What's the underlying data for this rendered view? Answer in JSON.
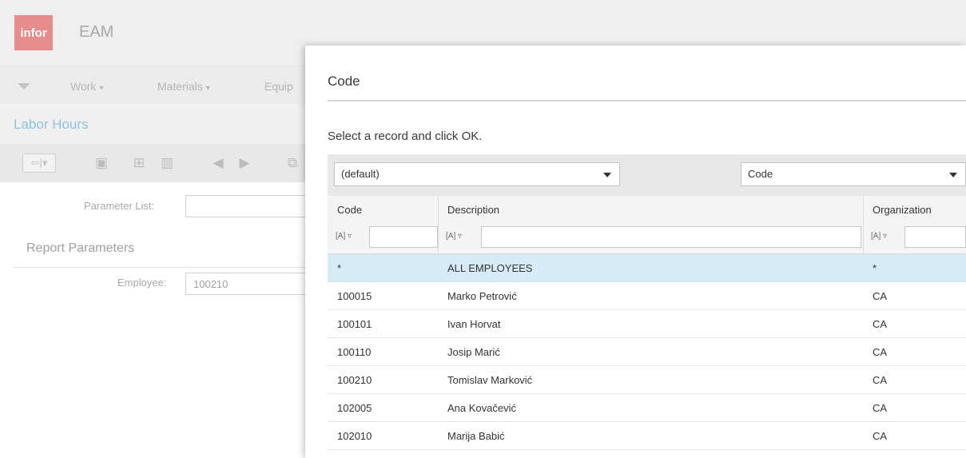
{
  "app": {
    "logo_text": "infor",
    "name": "EAM"
  },
  "menu": {
    "items": [
      "Work",
      "Materials",
      "Equip"
    ]
  },
  "page": {
    "title": "Labor Hours"
  },
  "form": {
    "parameter_list_label": "Parameter List:",
    "parameter_list_value": "",
    "report_params_heading": "Report Parameters",
    "employee_label": "Employee:",
    "employee_value": "100210"
  },
  "dialog": {
    "title": "Code",
    "instruction": "Select a record and click OK.",
    "dataspy_select": "(default)",
    "field_select": "Code",
    "columns": [
      "Code",
      "Description",
      "Organization"
    ],
    "filter_tag": "[A] ▿",
    "rows": [
      {
        "code": "*",
        "description": "ALL EMPLOYEES",
        "organization": "*",
        "selected": true
      },
      {
        "code": "100015",
        "description": "Marko Petrović",
        "organization": "CA"
      },
      {
        "code": "100101",
        "description": "Ivan Horvat",
        "organization": "CA"
      },
      {
        "code": "100110",
        "description": "Josip Marić",
        "organization": "CA"
      },
      {
        "code": "100210",
        "description": "Tomislav Marković",
        "organization": "CA"
      },
      {
        "code": "102005",
        "description": "Ana Kovačević",
        "organization": "CA"
      },
      {
        "code": "102010",
        "description": "Marija Babić",
        "organization": "CA"
      }
    ]
  },
  "colors": {
    "logo_bg": "#e58c8c",
    "title_accent": "#8dc3e0",
    "selected_row": "#d6ebf6"
  }
}
